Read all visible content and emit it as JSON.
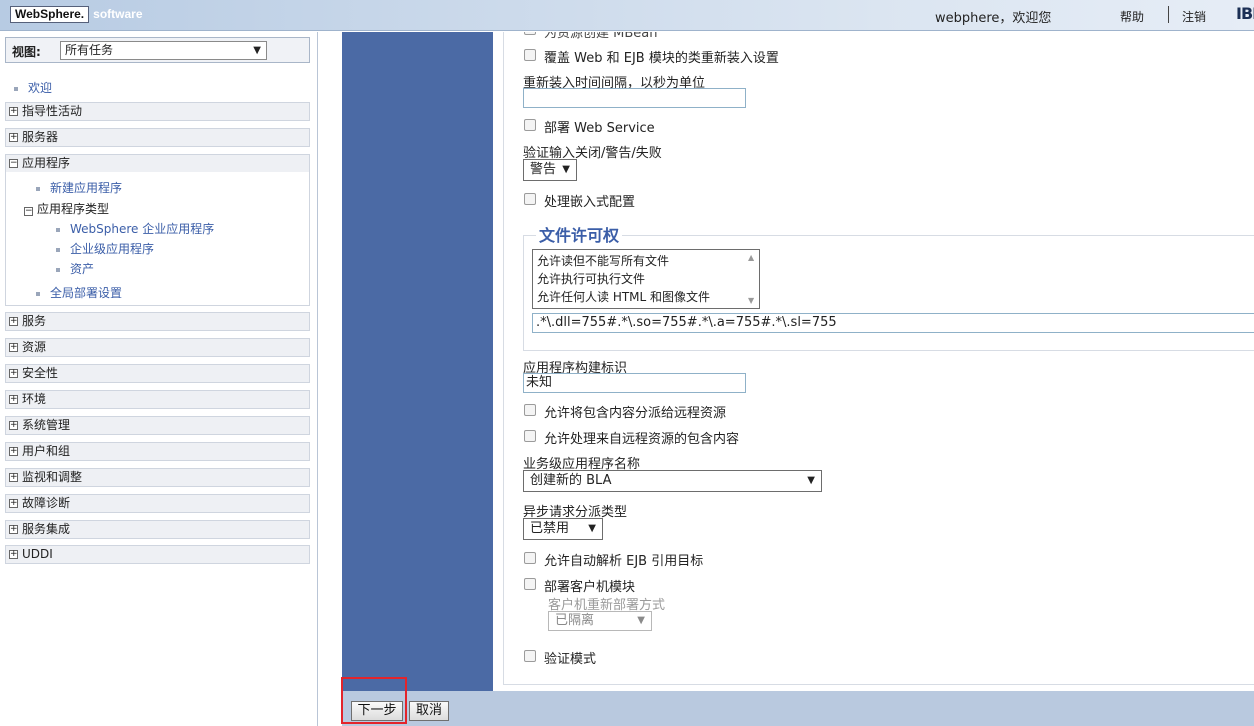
{
  "banner": {
    "logo_brand": "WebSphere.",
    "logo_software": "software",
    "welcome": "webphere，欢迎您",
    "help": "帮助",
    "logout": "注销",
    "ibm": "IBM"
  },
  "nav": {
    "view_label": "视图:",
    "view_value": "所有任务",
    "welcome": "欢迎",
    "sections": {
      "guided": "指导性活动",
      "servers": "服务器",
      "applications": "应用程序",
      "services": "服务",
      "resources": "资源",
      "security": "安全性",
      "environment": "环境",
      "system_admin": "系统管理",
      "users_groups": "用户和组",
      "monitoring": "监视和调整",
      "troubleshooting": "故障诊断",
      "service_integration": "服务集成",
      "uddi": "UDDI"
    },
    "app_sub": {
      "new_app": "新建应用程序",
      "app_types": "应用程序类型",
      "websphere_apps": "WebSphere 企业应用程序",
      "business_apps": "企业级应用程序",
      "assets": "资产",
      "global_deploy": "全局部署设置"
    }
  },
  "form": {
    "partial_top": "为资源创建 MBean",
    "override_reload": "覆盖 Web 和 EJB 模块的类重新装入设置",
    "reload_interval_label": "重新装入时间间隔，以秒为单位",
    "reload_interval_value": "",
    "deploy_ws": "部署 Web Service",
    "validate_input_label": "验证输入关闭/警告/失败",
    "validate_input_value": "警告",
    "process_embedded": "处理嵌入式配置",
    "file_perm_legend": "文件许可权",
    "file_perm_options": [
      "允许读但不能写所有文件",
      "允许执行可执行文件",
      "允许任何人读 HTML 和图像文件"
    ],
    "file_perm_value": ".*\\.dll=755#.*\\.so=755#.*\\.a=755#.*\\.sl=755",
    "build_id_label": "应用程序构建标识",
    "build_id_value": "未知",
    "allow_dispatch": "允许将包含内容分派给远程资源",
    "allow_process": "允许处理来自远程资源的包含内容",
    "bla_label": "业务级应用程序名称",
    "bla_value": "创建新的 BLA",
    "async_label": "异步请求分派类型",
    "async_value": "已禁用",
    "ejb_resolve": "允许自动解析 EJB 引用目标",
    "deploy_client": "部署客户机模块",
    "client_redeploy_label": "客户机重新部署方式",
    "client_redeploy_value": "已隔离",
    "validate_mode": "验证模式"
  },
  "buttons": {
    "next": "下一步",
    "cancel": "取消"
  }
}
